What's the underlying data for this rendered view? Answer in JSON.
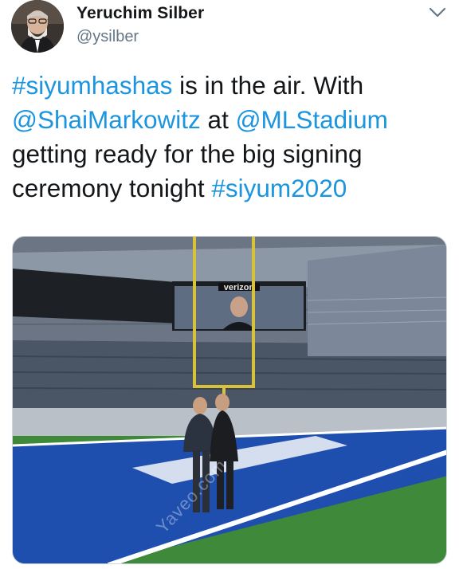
{
  "author": {
    "display_name": "Yeruchim Silber",
    "handle": "@ysilber"
  },
  "tweet": {
    "segments": [
      {
        "text": "#siyumhashas",
        "type": "hashtag"
      },
      {
        "text": " is in the air. With ",
        "type": "text"
      },
      {
        "text": "@ShaiMarkowitz",
        "type": "mention"
      },
      {
        "text": " at ",
        "type": "text"
      },
      {
        "text": "@MLStadium",
        "type": "mention"
      },
      {
        "text": " getting ready for the big signing ceremony tonight ",
        "type": "text"
      },
      {
        "text": "#siyum2020",
        "type": "hashtag"
      }
    ]
  },
  "media": {
    "scoreboard_brand": "verizon",
    "watermark": "Yaveo.com"
  },
  "icons": {
    "menu": "chevron-down-icon",
    "avatar": "avatar"
  },
  "colors": {
    "link": "#1b95e0",
    "name": "#14171a",
    "handle": "#657786"
  }
}
